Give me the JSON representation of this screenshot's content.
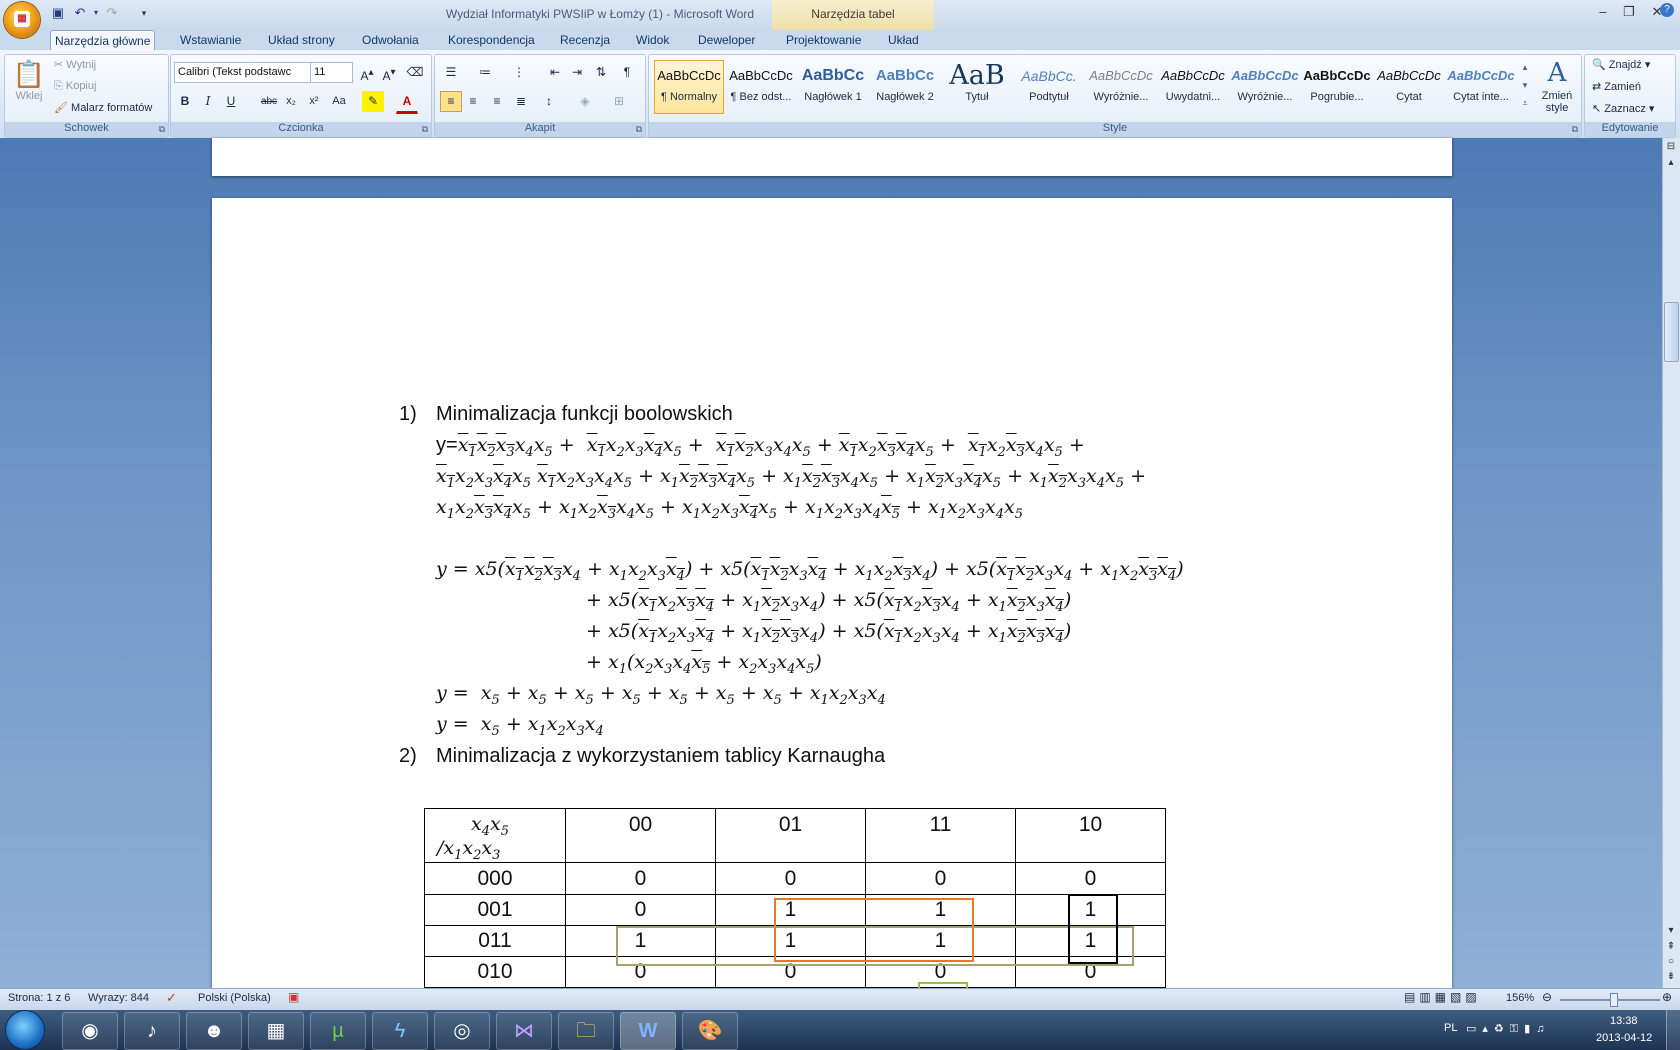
{
  "window": {
    "title": "Wydział Informatyki PWSIiP w Łomży (1) - Microsoft Word",
    "context_tab_title": "Narzędzia tabel"
  },
  "tabs": [
    "Narzędzia główne",
    "Wstawianie",
    "Układ strony",
    "Odwołania",
    "Korespondencja",
    "Recenzja",
    "Widok",
    "Deweloper",
    "Projektowanie",
    "Układ"
  ],
  "ribbon": {
    "clipboard": {
      "paste": "Wklej",
      "cut": "Wytnij",
      "copy": "Kopiuj",
      "painter": "Malarz formatów",
      "label": "Schowek"
    },
    "font": {
      "name": "Calibri (Tekst podstawc",
      "size": "11",
      "label": "Czcionka"
    },
    "paragraph": {
      "label": "Akapit"
    },
    "styles": {
      "label": "Style",
      "items": [
        {
          "preview": "AaBbCcDc",
          "name": "¶ Normalny"
        },
        {
          "preview": "AaBbCcDc",
          "name": "¶ Bez odst..."
        },
        {
          "preview": "AaBbCc",
          "name": "Nagłówek 1"
        },
        {
          "preview": "AaBbCc",
          "name": "Nagłówek 2"
        },
        {
          "preview": "AaB",
          "name": "Tytuł"
        },
        {
          "preview": "AaBbCc.",
          "name": "Podtytuł"
        },
        {
          "preview": "AaBbCcDc",
          "name": "Wyróżnie..."
        },
        {
          "preview": "AaBbCcDc",
          "name": "Uwydatni..."
        },
        {
          "preview": "AaBbCcDc",
          "name": "Wyróżnie..."
        },
        {
          "preview": "AaBbCcDc",
          "name": "Pogrubie..."
        },
        {
          "preview": "AaBbCcDc",
          "name": "Cytat"
        },
        {
          "preview": "AaBbCcDc",
          "name": "Cytat inte..."
        }
      ],
      "change": "Zmień style"
    },
    "editing": {
      "find": "Znajdź",
      "replace": "Zamień",
      "select": "Zaznacz",
      "label": "Edytowanie"
    }
  },
  "document": {
    "heading1": "Minimalizacja funkcji boolowskich",
    "heading1_num": "1)",
    "heading2": "Minimalizacja z wykorzystaniem tablicy Karnaugha",
    "heading2_num": "2)",
    "y_label": "y=",
    "kmap": {
      "corner_top": "x4x5",
      "corner_bottom": "/x1x2x3",
      "columns": [
        "00",
        "01",
        "11",
        "10"
      ],
      "rows": [
        {
          "label": "000",
          "values": [
            "0",
            "0",
            "0",
            "0"
          ]
        },
        {
          "label": "001",
          "values": [
            "0",
            "1",
            "1",
            "1"
          ]
        },
        {
          "label": "011",
          "values": [
            "1",
            "1",
            "1",
            "1"
          ]
        },
        {
          "label": "010",
          "values": [
            "0",
            "0",
            "0",
            "0"
          ]
        }
      ]
    }
  },
  "statusbar": {
    "page": "Strona: 1 z 6",
    "words": "Wyrazy: 844",
    "language": "Polski (Polska)",
    "zoom": "156%"
  },
  "tray": {
    "lang": "PL",
    "time": "13:38",
    "date": "2013-04-12"
  },
  "colors": {
    "orange_group": "#e07b2a",
    "olive_group": "#a8a070",
    "black_group": "#000000"
  }
}
